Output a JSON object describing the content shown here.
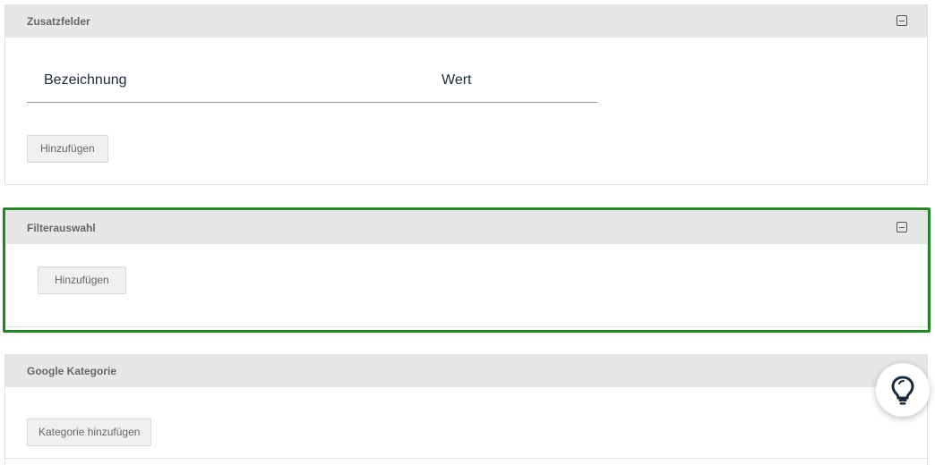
{
  "panels": {
    "zusatzfelder": {
      "title": "Zusatzfelder",
      "columns": [
        "Bezeichnung",
        "Wert"
      ],
      "add_label": "Hinzufügen"
    },
    "filterauswahl": {
      "title": "Filterauswahl",
      "add_label": "Hinzufügen"
    },
    "google_kategorie": {
      "title": "Google Kategorie",
      "add_label": "Kategorie hinzufügen"
    }
  },
  "icons": {
    "collapse": "minus-square-icon",
    "help": "lightbulb-icon"
  },
  "colors": {
    "highlight": "#1f8a1f",
    "header_bg": "#e7e7e7",
    "fab_icon": "#1a2b3c"
  }
}
